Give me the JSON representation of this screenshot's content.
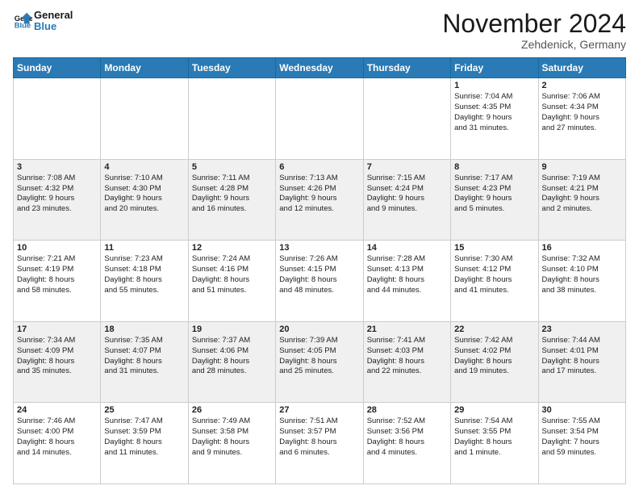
{
  "logo": {
    "line1": "General",
    "line2": "Blue"
  },
  "title": "November 2024",
  "location": "Zehdenick, Germany",
  "days_of_week": [
    "Sunday",
    "Monday",
    "Tuesday",
    "Wednesday",
    "Thursday",
    "Friday",
    "Saturday"
  ],
  "weeks": [
    [
      {
        "day": "",
        "info": ""
      },
      {
        "day": "",
        "info": ""
      },
      {
        "day": "",
        "info": ""
      },
      {
        "day": "",
        "info": ""
      },
      {
        "day": "",
        "info": ""
      },
      {
        "day": "1",
        "info": "Sunrise: 7:04 AM\nSunset: 4:35 PM\nDaylight: 9 hours\nand 31 minutes."
      },
      {
        "day": "2",
        "info": "Sunrise: 7:06 AM\nSunset: 4:34 PM\nDaylight: 9 hours\nand 27 minutes."
      }
    ],
    [
      {
        "day": "3",
        "info": "Sunrise: 7:08 AM\nSunset: 4:32 PM\nDaylight: 9 hours\nand 23 minutes."
      },
      {
        "day": "4",
        "info": "Sunrise: 7:10 AM\nSunset: 4:30 PM\nDaylight: 9 hours\nand 20 minutes."
      },
      {
        "day": "5",
        "info": "Sunrise: 7:11 AM\nSunset: 4:28 PM\nDaylight: 9 hours\nand 16 minutes."
      },
      {
        "day": "6",
        "info": "Sunrise: 7:13 AM\nSunset: 4:26 PM\nDaylight: 9 hours\nand 12 minutes."
      },
      {
        "day": "7",
        "info": "Sunrise: 7:15 AM\nSunset: 4:24 PM\nDaylight: 9 hours\nand 9 minutes."
      },
      {
        "day": "8",
        "info": "Sunrise: 7:17 AM\nSunset: 4:23 PM\nDaylight: 9 hours\nand 5 minutes."
      },
      {
        "day": "9",
        "info": "Sunrise: 7:19 AM\nSunset: 4:21 PM\nDaylight: 9 hours\nand 2 minutes."
      }
    ],
    [
      {
        "day": "10",
        "info": "Sunrise: 7:21 AM\nSunset: 4:19 PM\nDaylight: 8 hours\nand 58 minutes."
      },
      {
        "day": "11",
        "info": "Sunrise: 7:23 AM\nSunset: 4:18 PM\nDaylight: 8 hours\nand 55 minutes."
      },
      {
        "day": "12",
        "info": "Sunrise: 7:24 AM\nSunset: 4:16 PM\nDaylight: 8 hours\nand 51 minutes."
      },
      {
        "day": "13",
        "info": "Sunrise: 7:26 AM\nSunset: 4:15 PM\nDaylight: 8 hours\nand 48 minutes."
      },
      {
        "day": "14",
        "info": "Sunrise: 7:28 AM\nSunset: 4:13 PM\nDaylight: 8 hours\nand 44 minutes."
      },
      {
        "day": "15",
        "info": "Sunrise: 7:30 AM\nSunset: 4:12 PM\nDaylight: 8 hours\nand 41 minutes."
      },
      {
        "day": "16",
        "info": "Sunrise: 7:32 AM\nSunset: 4:10 PM\nDaylight: 8 hours\nand 38 minutes."
      }
    ],
    [
      {
        "day": "17",
        "info": "Sunrise: 7:34 AM\nSunset: 4:09 PM\nDaylight: 8 hours\nand 35 minutes."
      },
      {
        "day": "18",
        "info": "Sunrise: 7:35 AM\nSunset: 4:07 PM\nDaylight: 8 hours\nand 31 minutes."
      },
      {
        "day": "19",
        "info": "Sunrise: 7:37 AM\nSunset: 4:06 PM\nDaylight: 8 hours\nand 28 minutes."
      },
      {
        "day": "20",
        "info": "Sunrise: 7:39 AM\nSunset: 4:05 PM\nDaylight: 8 hours\nand 25 minutes."
      },
      {
        "day": "21",
        "info": "Sunrise: 7:41 AM\nSunset: 4:03 PM\nDaylight: 8 hours\nand 22 minutes."
      },
      {
        "day": "22",
        "info": "Sunrise: 7:42 AM\nSunset: 4:02 PM\nDaylight: 8 hours\nand 19 minutes."
      },
      {
        "day": "23",
        "info": "Sunrise: 7:44 AM\nSunset: 4:01 PM\nDaylight: 8 hours\nand 17 minutes."
      }
    ],
    [
      {
        "day": "24",
        "info": "Sunrise: 7:46 AM\nSunset: 4:00 PM\nDaylight: 8 hours\nand 14 minutes."
      },
      {
        "day": "25",
        "info": "Sunrise: 7:47 AM\nSunset: 3:59 PM\nDaylight: 8 hours\nand 11 minutes."
      },
      {
        "day": "26",
        "info": "Sunrise: 7:49 AM\nSunset: 3:58 PM\nDaylight: 8 hours\nand 9 minutes."
      },
      {
        "day": "27",
        "info": "Sunrise: 7:51 AM\nSunset: 3:57 PM\nDaylight: 8 hours\nand 6 minutes."
      },
      {
        "day": "28",
        "info": "Sunrise: 7:52 AM\nSunset: 3:56 PM\nDaylight: 8 hours\nand 4 minutes."
      },
      {
        "day": "29",
        "info": "Sunrise: 7:54 AM\nSunset: 3:55 PM\nDaylight: 8 hours\nand 1 minute."
      },
      {
        "day": "30",
        "info": "Sunrise: 7:55 AM\nSunset: 3:54 PM\nDaylight: 7 hours\nand 59 minutes."
      }
    ]
  ]
}
